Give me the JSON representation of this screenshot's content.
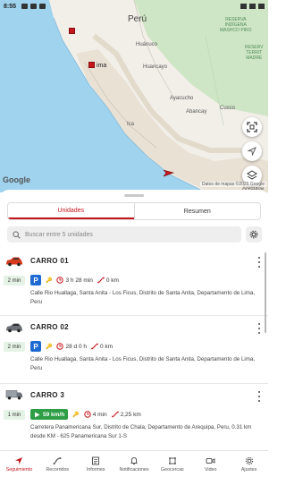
{
  "status_bar": {
    "time": "8:55"
  },
  "map": {
    "country_label": "Perú",
    "reserve_label_1": "RESERVA\nINDÍGENA\nMASHCO PIRO",
    "reserve_label_2": "RESERV\nTERRIT\nMADRE",
    "cities": [
      "Huánuco",
      "Huancayo",
      "Ayacucho",
      "Abancay",
      "Cusco",
      "Ica",
      "Arequipa"
    ],
    "marker_label": "ima",
    "google_logo": "Google",
    "attribution": "Datos de mapas ©2025 Google",
    "colors": {
      "marker": "#c4161c",
      "sea": "#9fd3ee",
      "land": "#f2efe9",
      "forest": "#cfe6c6"
    },
    "buttons": [
      {
        "name": "fit-bounds-icon"
      },
      {
        "name": "navigate-icon"
      },
      {
        "name": "layers-icon"
      }
    ]
  },
  "tabs": [
    {
      "label": "Unidades",
      "active": true
    },
    {
      "label": "Resumen",
      "active": false
    }
  ],
  "search": {
    "placeholder": "Buscar entre 5 unidades"
  },
  "units": [
    {
      "name": "CARRO 01",
      "icon": "red-car-icon",
      "age": "2 min",
      "state": "parked",
      "duration": "3 h 28 min",
      "distance": "0 km",
      "address": "Calle Rio Huallaga, Santa Anita - Los Ficus, Distrito de Santa Anita, Departamento de Lima, Peru"
    },
    {
      "name": "CARRO 02",
      "icon": "gray-car-icon",
      "age": "2 min",
      "state": "parked",
      "duration": "28 d 0 h",
      "distance": "0 km",
      "address": "Calle Rio Huallaga, Santa Anita - Los Ficus, Distrito de Santa Anita, Departamento de Lima, Peru"
    },
    {
      "name": "CARRO 3",
      "icon": "truck-icon",
      "age": "1 min",
      "state": "moving",
      "speed": "59 km/h",
      "duration": "4 min",
      "distance": "2,25 km",
      "address": "Carretera Panamericana Sur, Distrito de Chala, Departamento de Arequipa, Peru, 0.31 km desde KM - 625 Panamericana Sur 1-S"
    }
  ],
  "bottom_nav": [
    {
      "label": "Seguimiento",
      "icon": "navigation-arrow-icon",
      "active": true
    },
    {
      "label": "Recorridos",
      "icon": "route-icon",
      "active": false
    },
    {
      "label": "Informes",
      "icon": "report-icon",
      "active": false
    },
    {
      "label": "Notificaciones",
      "icon": "bell-icon",
      "active": false
    },
    {
      "label": "Geocercas",
      "icon": "geofence-icon",
      "active": false
    },
    {
      "label": "Video",
      "icon": "video-icon",
      "active": false
    },
    {
      "label": "Ajustes",
      "icon": "gear-icon",
      "active": false
    }
  ],
  "accent_color": "#c4161c"
}
